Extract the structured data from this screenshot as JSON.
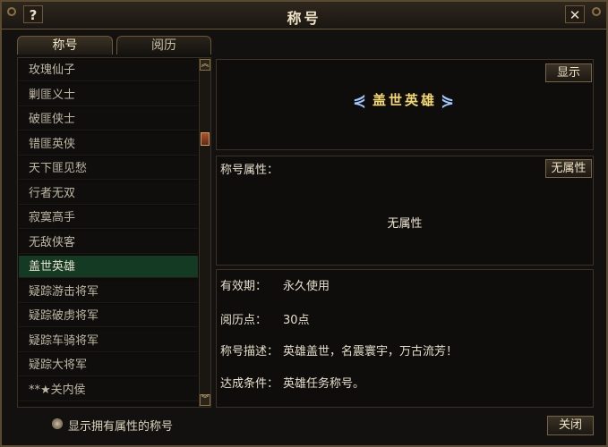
{
  "window": {
    "title": "称号",
    "help_glyph": "?",
    "close_glyph": "✕"
  },
  "tabs": [
    {
      "label": "称号"
    },
    {
      "label": "阅历"
    }
  ],
  "list": {
    "items": [
      "玫瑰仙子",
      "剿匪义士",
      "破匪侠士",
      "错匪英侠",
      "天下匪见愁",
      "行者无双",
      "寂寞高手",
      "无敌侠客",
      "盖世英雄",
      "疑踪游击将军",
      "疑踪破虏将军",
      "疑踪车骑将军",
      "疑踪大将军",
      "**★关内侯"
    ],
    "selected_index": 8
  },
  "scrollbar": {
    "up": "︽",
    "down": "︾",
    "position_fraction": 0.2
  },
  "detail": {
    "show_button": "显示",
    "title_name": "盖世英雄",
    "wing_left": "⋞",
    "wing_right": "⋟",
    "attr_label": "称号属性：",
    "attr_button": "无属性",
    "attr_value": "无属性",
    "info": [
      {
        "key": "有效期：",
        "value": "永久使用"
      },
      {
        "key": "阅历点：",
        "value": "30点"
      },
      {
        "key": "称号描述：",
        "value": "英雄盖世，名震寰宇，万古流芳！"
      },
      {
        "key": "达成条件：",
        "value": "英雄任务称号。"
      }
    ]
  },
  "footer": {
    "radio_label": "显示拥有属性的称号",
    "close_button": "关闭"
  },
  "colors": {
    "selected_row": "#143a23",
    "title_gold": "#f5d870",
    "frame": "#5a4a30"
  }
}
